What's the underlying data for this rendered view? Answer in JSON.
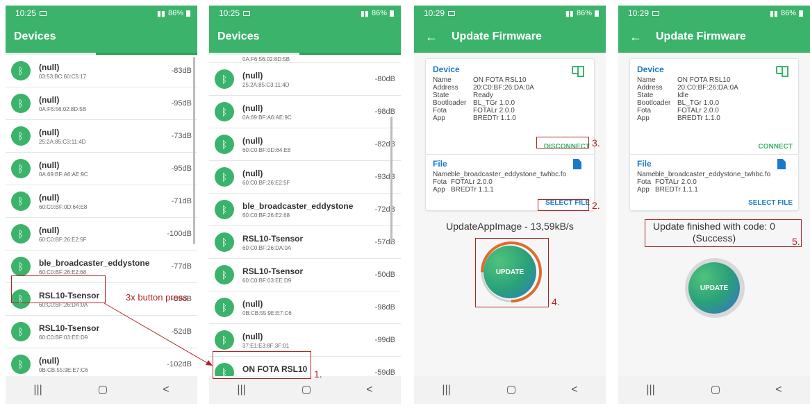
{
  "colors": {
    "brand_green": "#3bb36b",
    "link_blue": "#1a7ac9",
    "annotation_red": "#b22222"
  },
  "statusbar": {
    "screen1": {
      "time": "10:25",
      "right": "86%"
    },
    "screen2": {
      "time": "10:25",
      "right": "86%"
    },
    "screen3": {
      "time": "10:29",
      "right": "86%"
    },
    "screen4": {
      "time": "10:29",
      "right": "86%"
    }
  },
  "screen1": {
    "title": "Devices",
    "devices": [
      {
        "name": "(null)",
        "address": "03:53:BC:60:C5:17",
        "rssi": "-83dB"
      },
      {
        "name": "(null)",
        "address": "0A:F6:56:02:8D:5B",
        "rssi": "-95dB"
      },
      {
        "name": "(null)",
        "address": "25:2A:85:C3:11:4D",
        "rssi": "-73dB"
      },
      {
        "name": "(null)",
        "address": "0A:69:BF:A6:AE:9C",
        "rssi": "-95dB"
      },
      {
        "name": "(null)",
        "address": "60:C0:BF:0D:64:E8",
        "rssi": "-71dB"
      },
      {
        "name": "(null)",
        "address": "60:C0:BF:26:E2:5F",
        "rssi": "-100dB"
      },
      {
        "name": "ble_broadcaster_eddystone",
        "address": "60:C0:BF:26:E2:68",
        "rssi": "-77dB"
      },
      {
        "name": "RSL10-Tsensor",
        "address": "60:C0:BF:26:DA:0A",
        "rssi": "-59dB"
      },
      {
        "name": "RSL10-Tsensor",
        "address": "60:C0:BF:03:EE:D9",
        "rssi": "-52dB"
      },
      {
        "name": "(null)",
        "address": "0B:CB:55:9E:E7:C6",
        "rssi": "-102dB"
      },
      {
        "name": "(null)",
        "address": "",
        "rssi": ""
      }
    ],
    "annotation": "3x button press"
  },
  "screen2": {
    "title": "Devices",
    "partial_top": "0A:F6:56:02:8D:5B",
    "devices": [
      {
        "name": "(null)",
        "address": "25:2A:85:C3:11:4D",
        "rssi": "-80dB"
      },
      {
        "name": "(null)",
        "address": "0A:69:BF:A6:AE:9C",
        "rssi": "-98dB"
      },
      {
        "name": "(null)",
        "address": "60:C0:BF:0D:64:E8",
        "rssi": "-82dB"
      },
      {
        "name": "(null)",
        "address": "60:C0:BF:26:E2:5F",
        "rssi": "-93dB"
      },
      {
        "name": "ble_broadcaster_eddystone",
        "address": "60:C0:BF:26:E2:68",
        "rssi": "-72dB"
      },
      {
        "name": "RSL10-Tsensor",
        "address": "60:C0:BF:26:DA:0A",
        "rssi": "-57dB"
      },
      {
        "name": "RSL10-Tsensor",
        "address": "60:C0:BF:03:EE:D9",
        "rssi": "-50dB"
      },
      {
        "name": "(null)",
        "address": "0B:CB:55:9E:E7:C6",
        "rssi": "-98dB"
      },
      {
        "name": "(null)",
        "address": "37:E1:E3:8F:3F:01",
        "rssi": "-99dB"
      },
      {
        "name": "ON FOTA RSL10",
        "address": "20:C0:BF:26:DA:0A",
        "rssi": "-59dB"
      }
    ],
    "annotation": "1."
  },
  "screen3": {
    "title": "Update Firmware",
    "device_card": {
      "title": "Device",
      "rows": [
        {
          "k": "Name",
          "v": "ON FOTA RSL10"
        },
        {
          "k": "Address",
          "v": "20:C0:BF:26:DA:0A"
        },
        {
          "k": "State",
          "v": "Ready"
        },
        {
          "k": "Bootloader",
          "v": "BL_TGr 1.0.0"
        },
        {
          "k": "Fota",
          "v": "FOTALr 2.0.0"
        },
        {
          "k": "App",
          "v": "BREDTr 1.1.0"
        }
      ],
      "action": "DISCONNECT"
    },
    "file_card": {
      "title": "File",
      "rows": [
        {
          "k": "Name",
          "v": "ble_broadcaster_eddystone_twhbc.fo"
        },
        {
          "k": "Fota",
          "v": "FOTALr 2.0.0"
        },
        {
          "k": "App",
          "v": "BREDTr 1.1.1"
        }
      ],
      "action": "SELECT FILE"
    },
    "status": "UpdateAppImage - 13,59kB/s",
    "progress_fraction": 0.75,
    "button": "UPDATE",
    "annotations": {
      "disconnect": "3.",
      "select_file": "2.",
      "update": "4."
    }
  },
  "screen4": {
    "title": "Update Firmware",
    "device_card": {
      "title": "Device",
      "rows": [
        {
          "k": "Name",
          "v": "ON FOTA RSL10"
        },
        {
          "k": "Address",
          "v": "20:C0:BF:26:DA:0A"
        },
        {
          "k": "State",
          "v": "Idle"
        },
        {
          "k": "Bootloader",
          "v": "BL_TGr 1.0.0"
        },
        {
          "k": "Fota",
          "v": "FOTALr 2.0.0"
        },
        {
          "k": "App",
          "v": "BREDTr 1.1.0"
        }
      ],
      "action": "CONNECT"
    },
    "file_card": {
      "title": "File",
      "rows": [
        {
          "k": "Name",
          "v": "ble_broadcaster_eddystone_twhbc.fo"
        },
        {
          "k": "Fota",
          "v": "FOTALr 2.0.0"
        },
        {
          "k": "App",
          "v": "BREDTr 1.1.1"
        }
      ],
      "action": "SELECT FILE"
    },
    "status_line1": "Update finished with code: 0",
    "status_line2": "(Success)",
    "button": "UPDATE",
    "annotations": {
      "status": "5."
    }
  },
  "nav": {
    "recent": "|||",
    "back": "<"
  }
}
